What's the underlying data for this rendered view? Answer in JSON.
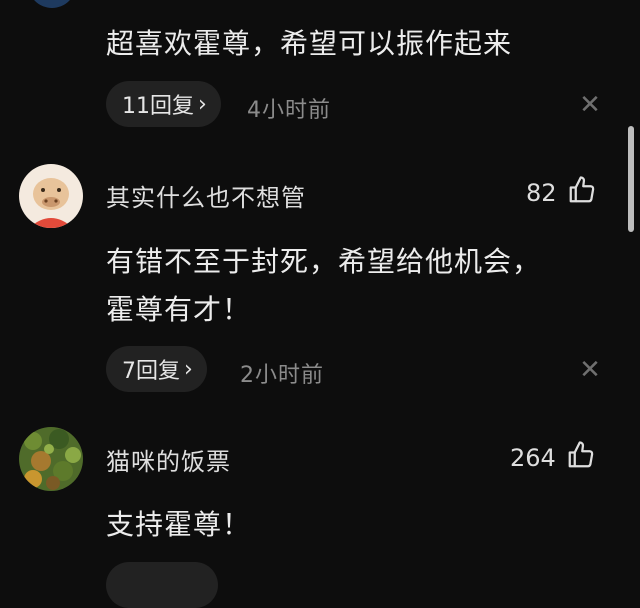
{
  "top_avatar_color": "#1e3a5f",
  "comments": [
    {
      "text": "超喜欢霍尊，希望可以振作起来",
      "reply_label": "11回复",
      "time": "4小时前"
    },
    {
      "username": "其实什么也不想管",
      "likes": "82",
      "text_lines": [
        "有错不至于封死，希望给他机会，",
        "霍尊有才！"
      ],
      "reply_label": "7回复",
      "time": "2小时前"
    },
    {
      "username": "猫咪的饭票",
      "likes": "264",
      "text": "支持霍尊！"
    }
  ],
  "icons": {
    "chevron": "›",
    "close": "✕",
    "like": "thumbs-up-icon"
  }
}
